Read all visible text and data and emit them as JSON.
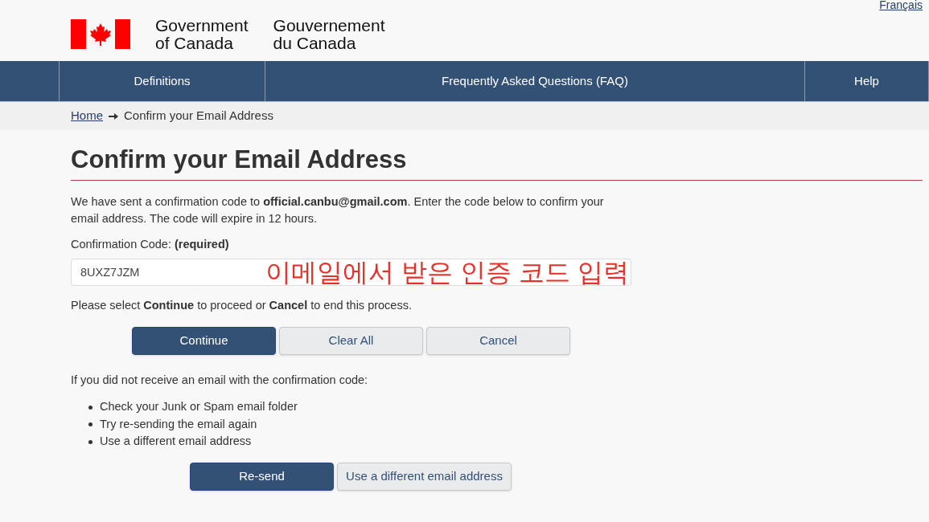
{
  "language_link": "Français",
  "header": {
    "title_en": [
      "Government",
      "of Canada"
    ],
    "title_fr": [
      "Gouvernement",
      "du Canada"
    ]
  },
  "nav": [
    {
      "label": "Definitions"
    },
    {
      "label": "Frequently Asked Questions (FAQ)"
    },
    {
      "label": "Help"
    }
  ],
  "breadcrumb": {
    "home": "Home",
    "current": "Confirm your Email Address"
  },
  "heading": "Confirm your Email Address",
  "intro": "We have sent a confirmation code to **official.canbu@gmail.com**. Enter the code below to confirm your email address. The code will expire in 12 hours.",
  "field": {
    "label": "Confirmation Code: **(required)**",
    "value": "8UXZ7JZM",
    "annotation": "이메일에서 받은 인증 코드 입력"
  },
  "instruction": "Please select **Continue** to proceed or **Cancel** to end this process.",
  "buttons": [
    {
      "label": "Continue",
      "kind": "primary"
    },
    {
      "label": "Clear All",
      "kind": "secondary"
    },
    {
      "label": "Cancel",
      "kind": "secondary"
    }
  ],
  "help_text": "If you did not receive an email with the confirmation code:",
  "tips": [
    "Check your Junk or Spam email folder",
    "Try re-sending the email again",
    "Use a different email address"
  ],
  "resend_buttons": [
    {
      "label": "Re-send",
      "kind": "primary"
    },
    {
      "label": "Use a different email address",
      "kind": "secondary"
    }
  ]
}
